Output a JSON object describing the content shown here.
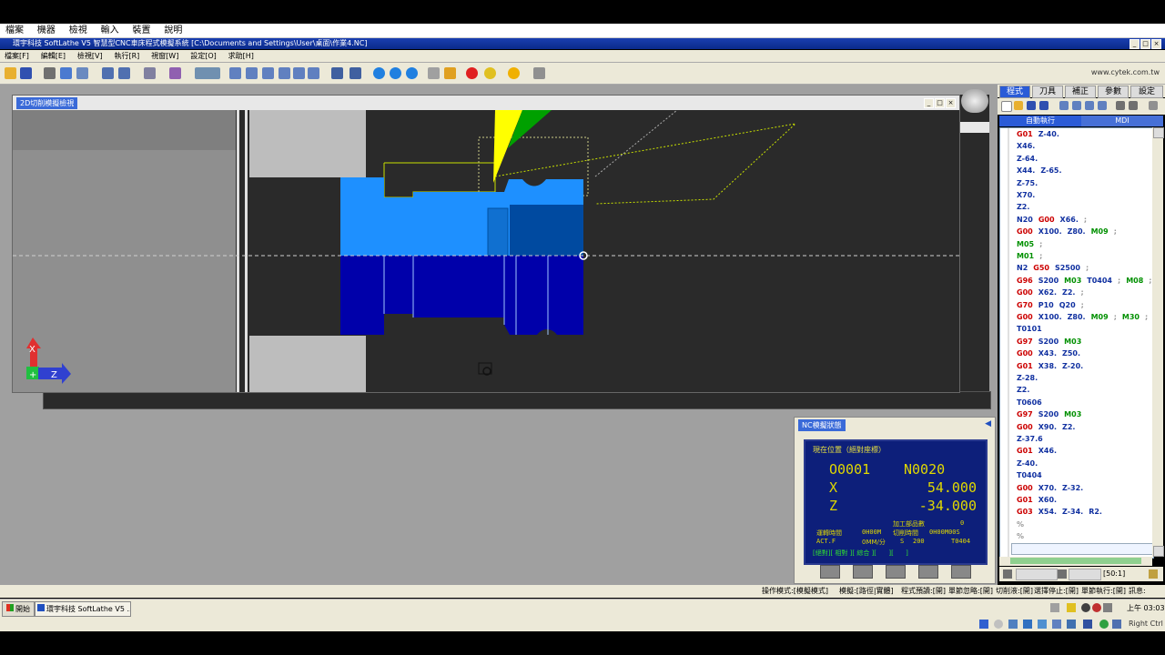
{
  "outer_menu": [
    "檔案",
    "機器",
    "檢視",
    "輸入",
    "裝置",
    "說明"
  ],
  "window": {
    "title": "環宇科技 SoftLathe V5 智慧型CNC車床程式模擬系統 [C:\\Documents and Settings\\User\\桌面\\作業4.NC]"
  },
  "app_menu": [
    "檔案[F]",
    "編輯[E]",
    "檢視[V]",
    "執行[R]",
    "視窗[W]",
    "設定[O]",
    "求助[H]"
  ],
  "toolbar": {
    "url": "www.cytek.com.tw"
  },
  "sim": {
    "title": "2D切削模擬檢視",
    "axis_x": "X",
    "axis_z": "Z"
  },
  "right_panel": {
    "tabs": [
      "程式",
      "刀具",
      "補正",
      "參數",
      "設定"
    ],
    "subtabs": [
      "自動執行",
      "MDI"
    ],
    "status": "[50:1]",
    "code": [
      [
        [
          "G01",
          "red"
        ],
        [
          "Z-40.",
          "blue"
        ]
      ],
      [
        [
          "X46.",
          "blue"
        ]
      ],
      [
        [
          "Z-64.",
          "blue"
        ]
      ],
      [
        [
          "X44.",
          "blue"
        ],
        [
          "Z-65.",
          "blue"
        ]
      ],
      [
        [
          "Z-75.",
          "blue"
        ]
      ],
      [
        [
          "X70.",
          "blue"
        ]
      ],
      [
        [
          "Z2.",
          "blue"
        ]
      ],
      [
        [
          "N20",
          "blue"
        ],
        [
          "G00",
          "red"
        ],
        [
          "X66.",
          "blue"
        ],
        [
          ";",
          "gray"
        ]
      ],
      [
        [
          "G00",
          "red"
        ],
        [
          "X100.",
          "blue"
        ],
        [
          "Z80.",
          "blue"
        ],
        [
          "M09",
          "green"
        ],
        [
          ";",
          "gray"
        ]
      ],
      [
        [
          "M05",
          "green"
        ],
        [
          ";",
          "gray"
        ]
      ],
      [
        [
          "M01",
          "green"
        ],
        [
          ";",
          "gray"
        ]
      ],
      [
        [
          "N2",
          "blue"
        ],
        [
          "G50",
          "red"
        ],
        [
          "S2500",
          "blue"
        ],
        [
          ";",
          "gray"
        ]
      ],
      [
        [
          "G96",
          "red"
        ],
        [
          "S200",
          "blue"
        ],
        [
          "M03",
          "green"
        ],
        [
          "T0404",
          "blue"
        ],
        [
          ";",
          "gray"
        ],
        [
          "M08",
          "green"
        ],
        [
          ";",
          "gray"
        ]
      ],
      [
        [
          "G00",
          "red"
        ],
        [
          "X62.",
          "blue"
        ],
        [
          "Z2.",
          "blue"
        ],
        [
          ";",
          "gray"
        ]
      ],
      [
        [
          "G70",
          "red"
        ],
        [
          "P10",
          "blue"
        ],
        [
          "Q20",
          "blue"
        ],
        [
          ";",
          "gray"
        ]
      ],
      [
        [
          "G00",
          "red"
        ],
        [
          "X100.",
          "blue"
        ],
        [
          "Z80.",
          "blue"
        ],
        [
          "M09",
          "green"
        ],
        [
          ";",
          "gray"
        ],
        [
          "M30",
          "green"
        ],
        [
          ";",
          "gray"
        ]
      ],
      [
        [
          "T0101",
          "blue"
        ]
      ],
      [
        [
          "G97",
          "red"
        ],
        [
          "S200",
          "blue"
        ],
        [
          "M03",
          "green"
        ]
      ],
      [
        [
          "G00",
          "red"
        ],
        [
          "X43.",
          "blue"
        ],
        [
          "Z50.",
          "blue"
        ]
      ],
      [
        [
          "G01",
          "red"
        ],
        [
          "X38.",
          "blue"
        ],
        [
          "Z-20.",
          "blue"
        ]
      ],
      [
        [
          "Z-28.",
          "blue"
        ]
      ],
      [
        [
          "Z2.",
          "blue"
        ]
      ],
      [
        [
          "T0606",
          "blue"
        ]
      ],
      [
        [
          "G97",
          "red"
        ],
        [
          "S200",
          "blue"
        ],
        [
          "M03",
          "green"
        ]
      ],
      [
        [
          "G00",
          "red"
        ],
        [
          "X90.",
          "blue"
        ],
        [
          "Z2.",
          "blue"
        ]
      ],
      [
        [
          "Z-37.6",
          "blue"
        ]
      ],
      [
        [
          "G01",
          "red"
        ],
        [
          "X46.",
          "blue"
        ]
      ],
      [
        [
          "Z-40.",
          "blue"
        ]
      ],
      [
        [
          "T0404",
          "blue"
        ]
      ],
      [
        [
          "G00",
          "red"
        ],
        [
          "X70.",
          "blue"
        ],
        [
          "Z-32.",
          "blue"
        ]
      ],
      [
        [
          "G01",
          "red"
        ],
        [
          "X60.",
          "blue"
        ]
      ],
      [
        [
          "G03",
          "red"
        ],
        [
          "X54.",
          "blue"
        ],
        [
          "Z-34.",
          "blue"
        ],
        [
          "R2.",
          "blue"
        ]
      ],
      [
        [
          "%",
          "gray"
        ]
      ],
      [
        [
          "%",
          "gray"
        ]
      ]
    ]
  },
  "nc_panel": {
    "title": "NC模擬狀態",
    "header": "現在位置（絕對座標）",
    "program": "O0001",
    "seq": "N0020",
    "x_label": "X",
    "x_value": "54.000",
    "z_label": "Z",
    "z_value": "-34.000",
    "parts_label": "加工部品數",
    "parts_value": "0",
    "run_label": "運轉時間",
    "run_value": "0H00M",
    "cut_label": "切削時間",
    "cut_value": "0H00M00S",
    "act_label": "ACT.F",
    "act_value": "0MM/分",
    "s_label": "S",
    "s_value": "200",
    "t_value": "T0404",
    "softkeys": "[絕對][ 相對 ][ 綜合 ][      ][      ]"
  },
  "status_bar": [
    "操作模式:[模擬模式]",
    "模擬:[路徑|實體]",
    "程式預讀:[開]",
    "單節忽略:[開]",
    "切削液:[開]",
    "選擇停止:[開]",
    "單節執行:[開]",
    "訊息:"
  ],
  "taskbar": {
    "start": "開始",
    "task": "環宇科技 SoftLathe V5 ...",
    "clock": "上午 03:03"
  },
  "sysbar": {
    "right": "Right Ctrl"
  },
  "colors": {
    "title_blue": "#0a2a8a",
    "part_light": "#1e90ff",
    "part_dark": "#0000aa",
    "tool_yellow": "#ffff00",
    "tool_green": "#00a000"
  }
}
